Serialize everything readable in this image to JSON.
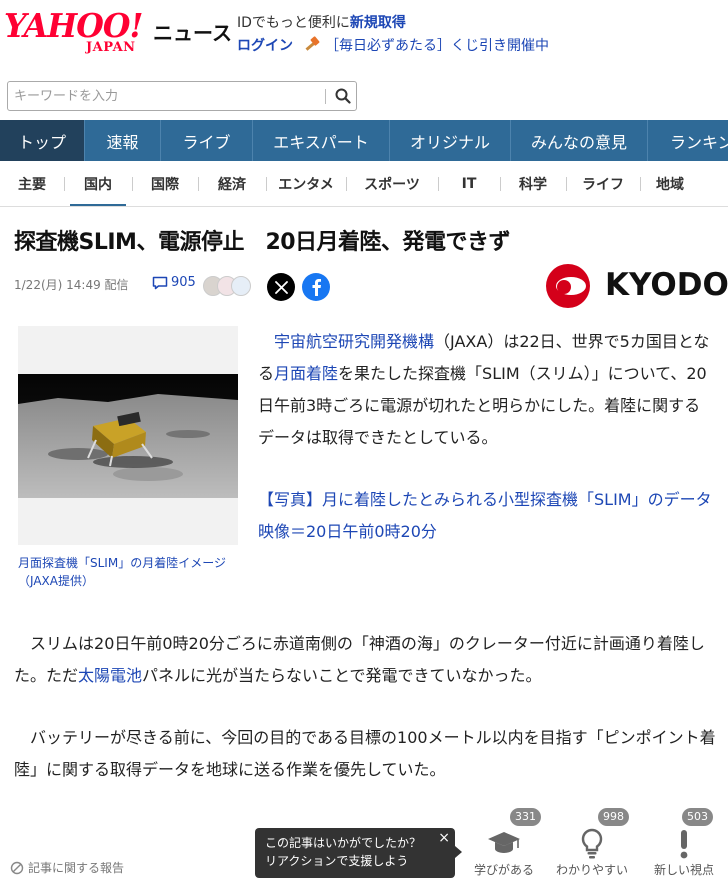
{
  "header": {
    "logo_main": "YAHOO!",
    "logo_sub": "JAPAN",
    "service": "ニュース",
    "id_text": "IDでもっと便利に",
    "register": "新規取得",
    "login": "ログイン",
    "promo": "［毎日必ずあたる］くじ引き開催中"
  },
  "search": {
    "placeholder": "キーワードを入力"
  },
  "nav_main": [
    {
      "label": "トップ"
    },
    {
      "label": "速報"
    },
    {
      "label": "ライブ"
    },
    {
      "label": "エキスパート"
    },
    {
      "label": "オリジナル"
    },
    {
      "label": "みんなの意見"
    },
    {
      "label": "ランキング"
    }
  ],
  "nav_sub": [
    {
      "label": "主要"
    },
    {
      "label": "国内"
    },
    {
      "label": "国際"
    },
    {
      "label": "経済"
    },
    {
      "label": "エンタメ"
    },
    {
      "label": "スポーツ"
    },
    {
      "label": "IT"
    },
    {
      "label": "科学"
    },
    {
      "label": "ライフ"
    },
    {
      "label": "地域"
    }
  ],
  "article": {
    "title": "探査機SLIM、電源停止　20日月着陸、発電できず",
    "date": "1/22(月) 14:49 配信",
    "comment_count": "905",
    "publisher": "KYODO",
    "photo_caption": "月面探査機「SLIM」の月着陸イメージ（JAXA提供）",
    "p1_link1": "宇宙航空研究開発機構",
    "p1_a": "（JAXA）は22日、世界で5カ国目となる",
    "p1_link2": "月面着陸",
    "p1_b": "を果たした探査機「SLIM（スリム）」について、20日午前3時ごろに電源が切れたと明らかにした。着陸に関するデータは取得できたとしている。",
    "p2": "【写真】月に着陸したとみられる小型探査機「SLIM」のデータ映像＝20日午前0時20分",
    "p3_a": "スリムは20日午前0時20分ごろに赤道南側の「神酒の海」のクレーター付近に計画通り着陸した。ただ",
    "p3_link": "太陽電池",
    "p3_b": "パネルに光が当たらないことで発電できていなかった。",
    "p4": "バッテリーが尽きる前に、今回の目的である目標の100メートル以内を目指す「ピンポイント着陸」に関する取得データを地球に送る作業を優先していた。"
  },
  "footer": {
    "report": "記事に関する報告",
    "tooltip_line1": "この記事はいかがでしたか？",
    "tooltip_line2": "リアクションで支援しよう",
    "tooltip_close": "×",
    "reactions": [
      {
        "label": "学びがある",
        "count": "331",
        "icon": "graduation-cap-icon"
      },
      {
        "label": "わかりやすい",
        "count": "998",
        "icon": "lightbulb-icon"
      },
      {
        "label": "新しい視点",
        "count": "503",
        "icon": "exclamation-icon"
      }
    ]
  },
  "colors": {
    "brand_red": "#ff0033",
    "nav_blue": "#2f6a97",
    "nav_active": "#22415c",
    "link_blue": "#1d47b5",
    "kyodo_red": "#d4001a"
  }
}
